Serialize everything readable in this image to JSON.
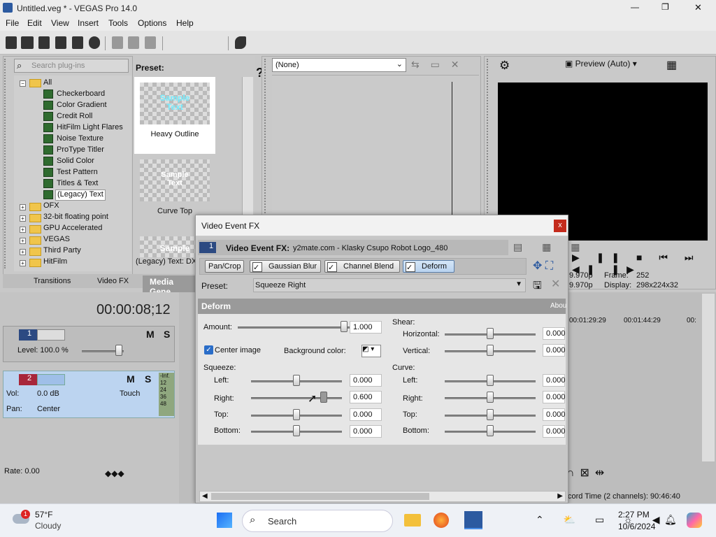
{
  "window": {
    "title": "Untitled.veg * - VEGAS Pro 14.0",
    "controls": {
      "minimize": "—",
      "maximize": "❐",
      "close": "✕"
    }
  },
  "menu": [
    "File",
    "Edit",
    "View",
    "Insert",
    "Tools",
    "Options",
    "Help"
  ],
  "plugins": {
    "search_placeholder": "Search plug-ins",
    "root": "All",
    "items": [
      "Checkerboard",
      "Color Gradient",
      "Credit Roll",
      "HitFilm Light Flares",
      "Noise Texture",
      "ProType Titler",
      "Solid Color",
      "Test Pattern",
      "Titles & Text",
      "(Legacy) Text"
    ],
    "folders": [
      "OFX",
      "32-bit floating point",
      "GPU Accelerated",
      "VEGAS",
      "Third Party",
      "HitFilm"
    ],
    "preset_header": "Preset:",
    "presets": [
      {
        "sample": "Sample Text",
        "label": "Heavy Outline"
      },
      {
        "sample": "Sample Text",
        "label": "Curve Top"
      },
      {
        "sample": "Sample",
        "label": "(Legacy) Text: DX"
      }
    ],
    "tabs": [
      "Transitions",
      "Video FX",
      "Media Gene"
    ]
  },
  "trimmer": {
    "dropdown": "(None)"
  },
  "preview": {
    "mode": "Preview (Auto)",
    "frame_label": "Frame:",
    "frame_value": "252",
    "display_label": "Display:",
    "display_value": "298x224x32",
    "rate1": "9.970p",
    "rate2": "9.970p"
  },
  "timeline": {
    "timecode": "00:00:08;12",
    "level": "Level: 100.0 %",
    "vol": "Vol:",
    "vol_value": "0.0 dB",
    "pan": "Pan:",
    "pan_value": "Center",
    "touch": "Touch",
    "rate": "Rate: 0.00",
    "ruler": [
      "00:01:29:29",
      "00:01:44:29",
      "00:"
    ],
    "meter": [
      "-Inf.",
      "12",
      "24",
      "36",
      "48"
    ],
    "track1": "1",
    "track2": "2",
    "record_time": "cord Time (2 channels): 90:46:40",
    "ms": [
      "M",
      "S"
    ]
  },
  "dialog": {
    "title": "Video Event FX",
    "close": "x",
    "fx_label": "Video Event FX:",
    "fx_name": "y2mate.com - Klasky Csupo Robot Logo_480",
    "track_number": "1",
    "chain": [
      "Pan/Crop",
      "Gaussian Blur",
      "Channel Blend",
      "Deform"
    ],
    "preset_label": "Preset:",
    "preset_value": "Squeeze Right",
    "section": "Deform",
    "about": "Abou",
    "amount_label": "Amount:",
    "amount_value": "1.000",
    "center_image": "Center image",
    "bg_color_label": "Background color:",
    "squeeze_label": "Squeeze:",
    "squeeze": [
      {
        "label": "Left:",
        "value": "0.000",
        "level": 0.5
      },
      {
        "label": "Right:",
        "value": "0.600",
        "level": 0.8
      },
      {
        "label": "Top:",
        "value": "0.000",
        "level": 0.5
      },
      {
        "label": "Bottom:",
        "value": "0.000",
        "level": 0.5
      }
    ],
    "shear_label": "Shear:",
    "shear": [
      {
        "label": "Horizontal:",
        "value": "0.000",
        "level": 0.5
      },
      {
        "label": "Vertical:",
        "value": "0.000",
        "level": 0.5
      }
    ],
    "curve_label": "Curve:",
    "curve": [
      {
        "label": "Left:",
        "value": "0.000",
        "level": 0.5
      },
      {
        "label": "Right:",
        "value": "0.000",
        "level": 0.5
      },
      {
        "label": "Top:",
        "value": "0.000",
        "level": 0.5
      },
      {
        "label": "Bottom:",
        "value": "0.000",
        "level": 0.5
      }
    ]
  },
  "taskbar": {
    "weather_temp": "57°F",
    "weather_desc": "Cloudy",
    "weather_badge": "1",
    "search": "Search",
    "time": "2:27 PM",
    "date": "10/6/2024"
  }
}
